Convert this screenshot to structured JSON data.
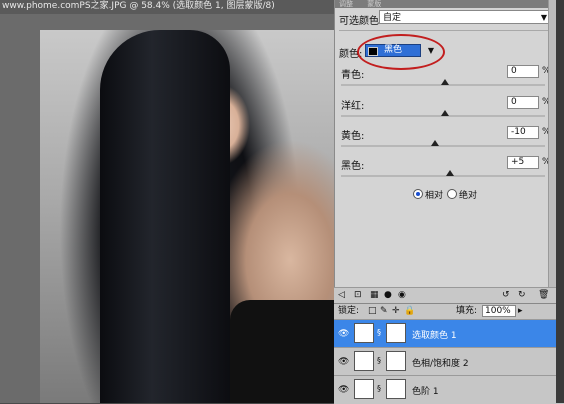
{
  "document": {
    "title": "www.phome.comPS之家.JPG @ 58.4% (选取颜色 1, 图层蒙版/8)"
  },
  "adjust_panel": {
    "tabs": [
      "调整",
      "蒙版"
    ],
    "preset_label": "可选颜色",
    "preset_value": "自定",
    "colors_label": "颜色:",
    "colors_value": "黑色",
    "sliders": [
      {
        "label": "青色:",
        "value": "0",
        "unit": "%"
      },
      {
        "label": "洋红:",
        "value": "0",
        "unit": "%"
      },
      {
        "label": "黄色:",
        "value": "-10",
        "unit": "%"
      },
      {
        "label": "黑色:",
        "value": "+5",
        "unit": "%"
      }
    ],
    "method": {
      "relative": "相对",
      "absolute": "绝对",
      "selected": "relative"
    }
  },
  "layers": {
    "lock_label": "锁定:",
    "fill_label": "填充:",
    "fill_value": "100%",
    "items": [
      {
        "name": "选取颜色 1",
        "selected": true
      },
      {
        "name": "色相/饱和度 2",
        "selected": false
      },
      {
        "name": "色阶 1",
        "selected": false
      }
    ]
  },
  "colors": {
    "selection_blue": "#3b86e8",
    "annotation_red": "#c21e1e"
  }
}
